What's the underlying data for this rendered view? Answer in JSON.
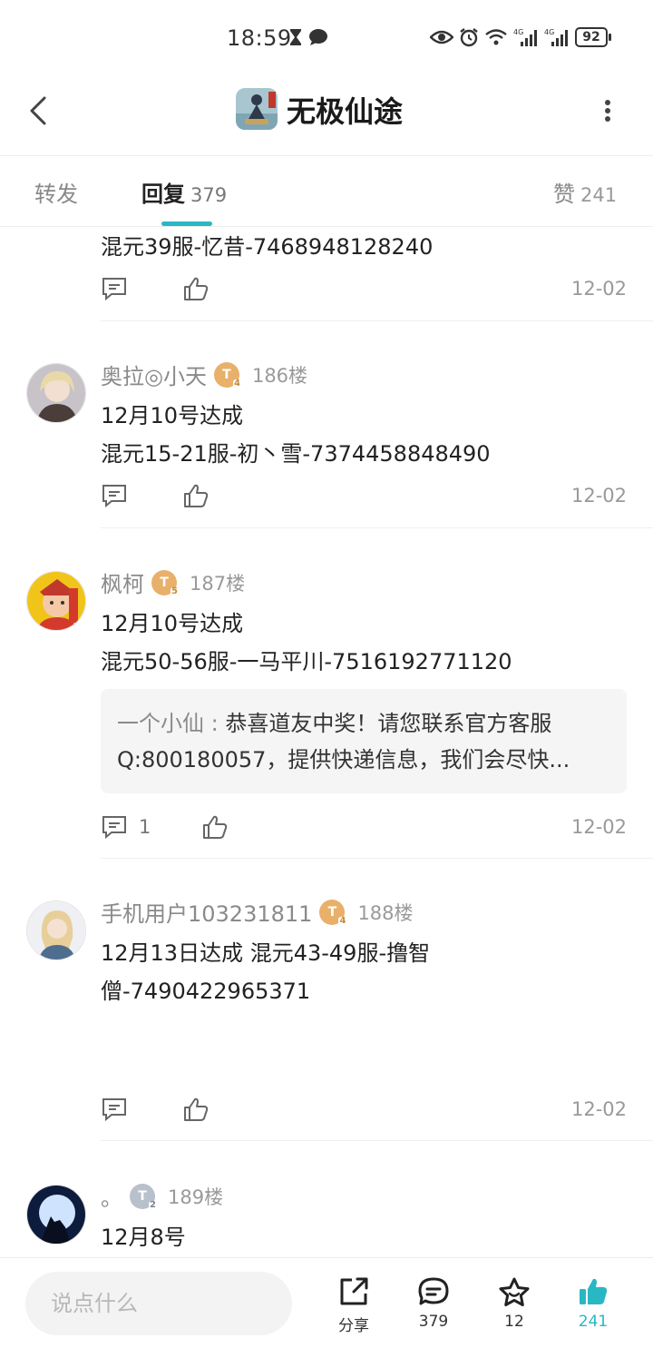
{
  "status_bar": {
    "time": "18:59",
    "battery": "92",
    "network_1": "4G",
    "network_2": "4G"
  },
  "header": {
    "title": "无极仙途",
    "back_icon": "back-chevron-icon",
    "more_icon": "more-vertical-icon"
  },
  "tabs": {
    "forward": {
      "label": "转发"
    },
    "reply": {
      "label": "回复",
      "count": "379"
    },
    "like": {
      "label": "赞",
      "count": "241"
    }
  },
  "posts": [
    {
      "lines": [
        "混元39服-忆昔-7468948128240"
      ],
      "date": "12-02"
    },
    {
      "username": "奥拉◎小天",
      "level": "T",
      "level_num": "4",
      "floor": "186楼",
      "lines": [
        "12月10号达成",
        "混元15-21服-初丶雪-7374458848490"
      ],
      "date": "12-02"
    },
    {
      "username": "枫柯",
      "level": "T",
      "level_num": "5",
      "floor": "187楼",
      "lines": [
        "12月10号达成",
        "混元50-56服-一马平川-7516192771120"
      ],
      "reply": {
        "author": "一个小仙 : ",
        "line1": "恭喜道友中奖！请您联系官方客服",
        "line2": "Q:800180057，提供快递信息，我们会尽快..."
      },
      "comment_count": "1",
      "date": "12-02"
    },
    {
      "username": "手机用户103231811",
      "level": "T",
      "level_num": "4",
      "floor": "188楼",
      "lines": [
        "12月13日达成 混元43-49服-撸智",
        "僧-7490422965371"
      ],
      "date": "12-02"
    },
    {
      "username": "。",
      "level": "T",
      "level_num": "2",
      "floor": "189楼",
      "lines": [
        "12月8号"
      ]
    }
  ],
  "bottom_bar": {
    "input_placeholder": "说点什么",
    "share_label": "分享",
    "comments_count": "379",
    "favorites_count": "12",
    "likes_count": "241"
  },
  "colors": {
    "accent": "#2ab7c4",
    "badge_gold": "#e8b06a",
    "badge_silver": "#b8c0cc"
  }
}
